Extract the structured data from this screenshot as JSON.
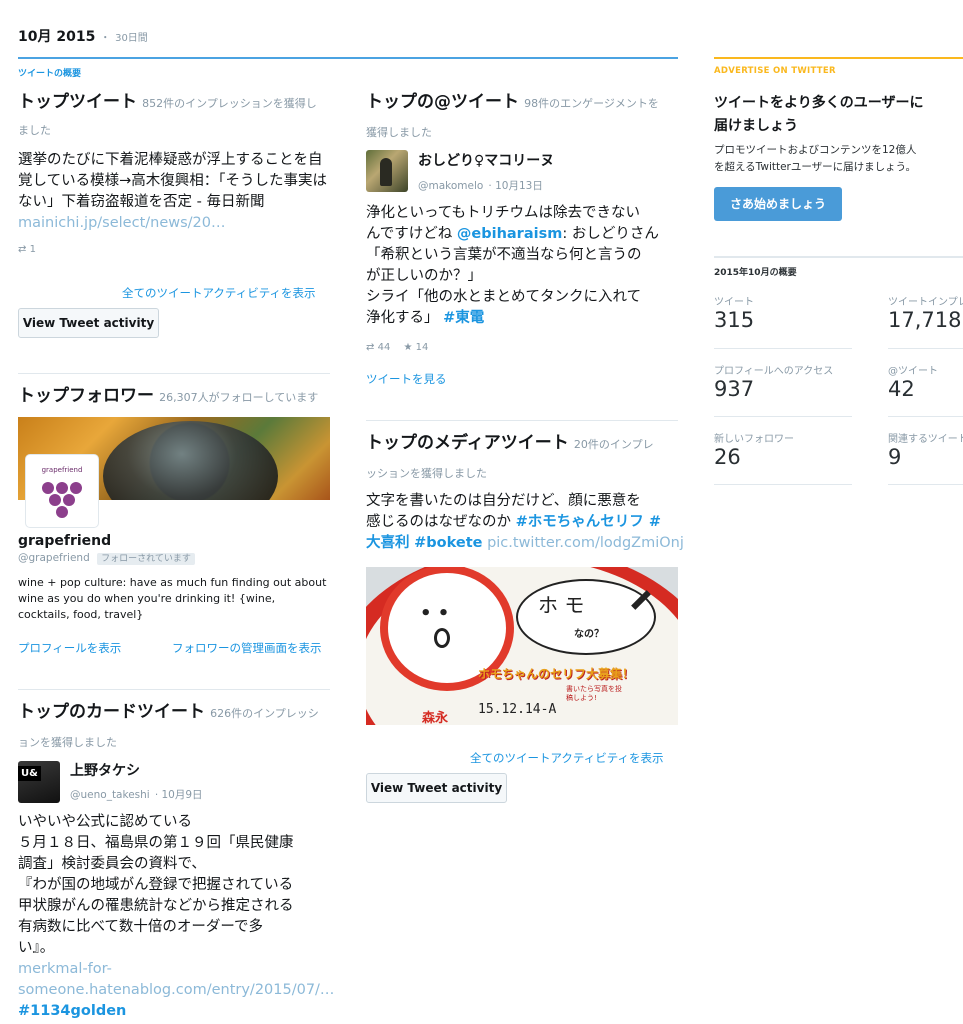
{
  "period": {
    "month": "10月 2015",
    "sep": "・",
    "days": "30日間"
  },
  "section_label": "ツイートの概要",
  "top_tweet": {
    "title": "トップツイート",
    "sub1": "852件のインプレッションを獲得し",
    "sub2": "ました",
    "text_plain": "選挙のたびに下着泥棒疑惑が浮上することを自覚している模様→高木復興相：「そうした事実はない」下着窃盗報道を否定 - 毎日新聞 ",
    "text_link": "mainichi.jp/select/news/20…",
    "retweets": "1",
    "all_activity": "全てのツイートアクティビティを表示",
    "button": "View Tweet activity"
  },
  "top_follower": {
    "title": "トップフォロワー",
    "sub": "26,307人がフォローしています",
    "avatar_text": "grapefriend",
    "name": "grapefriend",
    "handle": "@grapefriend",
    "follows_badge": "フォローされています",
    "bio": "wine + pop culture: have as much fun finding out about wine as you do when you're drinking it! {wine, cocktails, food, travel}",
    "view_profile": "プロフィールを表示",
    "manage_followers": "フォロワーの管理画面を表示"
  },
  "top_card_tweet": {
    "title": "トップのカードツイート",
    "sub1": "626件のインプレッシ",
    "sub2": "ョンを獲得しました",
    "name": "上野タケシ",
    "handle": "@ueno_takeshi",
    "date": "10月9日",
    "avatar_text": "U&",
    "lines": [
      "いやいや公式に認めている",
      "５月１８日、福島県の第１９回「県民健康",
      "調査」検討委員会の資料で、",
      "『わが国の地域がん登録で把握されている",
      "甲状腺がんの罹患統計などから推定される",
      "有病数に比べて数十倍のオーダーで多",
      "い』。"
    ],
    "link1": "merkmal-for-",
    "link2": "someone.hatenablog.com/entry/2015/07/…",
    "hashtag": "#1134golden"
  },
  "top_mention": {
    "title": "トップの@ツイート",
    "sub1": "98件のエンゲージメントを",
    "sub2": "獲得しました",
    "name": "おしどり♀マコリーヌ",
    "handle": "@makomelo",
    "date": "10月13日",
    "line1": "浄化といってもトリチウムは除去できない",
    "line2_a": "んですけどね ",
    "line2_mention": "@ebiharaism",
    "line2_b": ": おしどりさん",
    "line3": "「希釈という言葉が不適当なら何と言うの",
    "line4": "が正しいのか？」",
    "line5": "シライ「他の水とまとめてタンクに入れて",
    "line6_a": "浄化する」 ",
    "line6_tag": "#東電",
    "retweets": "44",
    "likes": "14",
    "view_tweet": "ツイートを見る"
  },
  "top_media": {
    "title": "トップのメディアツイート",
    "sub1": "20件のインプレ",
    "sub2": "ッションを獲得しました",
    "line1": "文字を書いたのは自分だけど、顔に悪意を",
    "line2_a": "感じるのはなぜなのか ",
    "line2_tag": "#ホモちゃんセリフ",
    "line2_hash": " #",
    "line3_tag1": "大喜利",
    "line3_tag2": "#bokete",
    "line3_link": "pic.twitter.com/lodgZmiOnj",
    "img_bubble1": "ホ モ",
    "img_bubble2": "なの？",
    "img_banner": "ホモちゃんのセリフ大募集！",
    "img_code": "15.12.14-A",
    "img_brand": "森永",
    "img_small": "書いたら写真を投稿しよう!",
    "all_activity": "全てのツイートアクティビティを表示",
    "button": "View Tweet activity"
  },
  "ad": {
    "label": "ADVERTISE ON TWITTER",
    "heading1": "ツイートをより多くのユーザーに",
    "heading2": "届けましょう",
    "desc1": "プロモツイートおよびコンテンツを12億人",
    "desc2": "を超えるTwitterユーザーに届けましょう。",
    "button": "さあ始めましょう",
    "accent": "#fab81e",
    "button_color": "#4a9bd8"
  },
  "summary": {
    "title": "2015年10月の概要",
    "stats": [
      {
        "label": "ツイート",
        "value": "315"
      },
      {
        "label": "ツイートインプレ",
        "value": "17,718"
      },
      {
        "label": "プロフィールへのアクセス",
        "value": "937"
      },
      {
        "label": "@ツイート",
        "value": "42"
      },
      {
        "label": "新しいフォロワー",
        "value": "26"
      },
      {
        "label": "関連するツイート",
        "value": "9"
      }
    ]
  },
  "colors": {
    "link": "#1b95e0",
    "rule_blue": "#4ba3e2",
    "rule_yellow": "#fab81e"
  }
}
